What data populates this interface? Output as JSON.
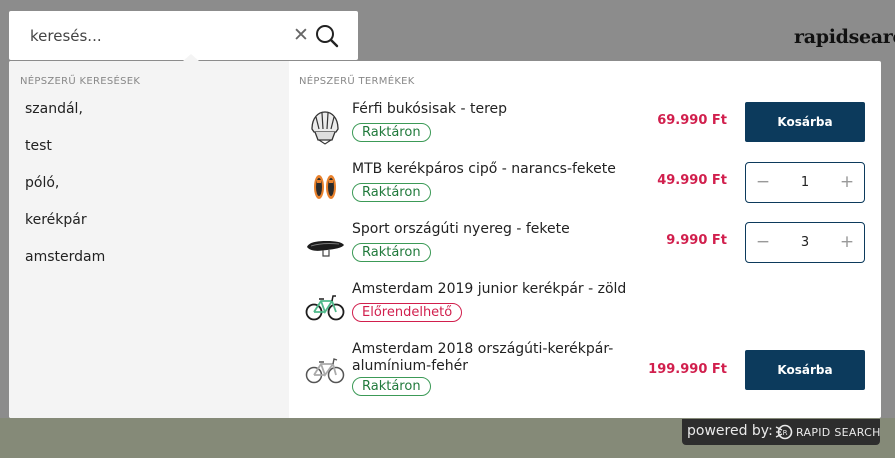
{
  "brand": "rapidsearc",
  "search": {
    "placeholder": "keresés...",
    "clear": "✕"
  },
  "popular_searches": {
    "title": "NÉPSZERŰ KERESÉSEK",
    "items": [
      "szandál,",
      "test",
      "póló,",
      "kerékpár",
      "amsterdam"
    ]
  },
  "popular_products": {
    "title": "NÉPSZERŰ TERMÉKEK",
    "items": [
      {
        "name": "Férfi bukósisak - terep",
        "status": "Raktáron",
        "price": "69.990 Ft",
        "action": "Kosárba",
        "thumb": "helmet"
      },
      {
        "name": "MTB kerékpáros cipő - narancs-fekete",
        "status": "Raktáron",
        "price": "49.990 Ft",
        "quantity": "1",
        "thumb": "shoes"
      },
      {
        "name": "Sport országúti nyereg - fekete",
        "status": "Raktáron",
        "price": "9.990 Ft",
        "quantity": "3",
        "thumb": "saddle"
      },
      {
        "name": "Amsterdam 2019 junior kerékpár - zöld",
        "status": "Előrendelhető",
        "thumb": "bike-green"
      },
      {
        "name": "Amsterdam 2018 országúti-kerékpár-alumínium-fehér",
        "status": "Raktáron",
        "price": "199.990 Ft",
        "action": "Kosárba",
        "thumb": "bike-white"
      }
    ]
  },
  "stepper": {
    "minus": "−",
    "plus": "+"
  },
  "footer": {
    "powered_by": "powered by:",
    "brand": "RAPID SEARCH"
  },
  "colors": {
    "accent": "#0c3a5c",
    "price": "#d11f4d",
    "in_stock": "#217a3c",
    "preorder": "#d11f4d"
  }
}
